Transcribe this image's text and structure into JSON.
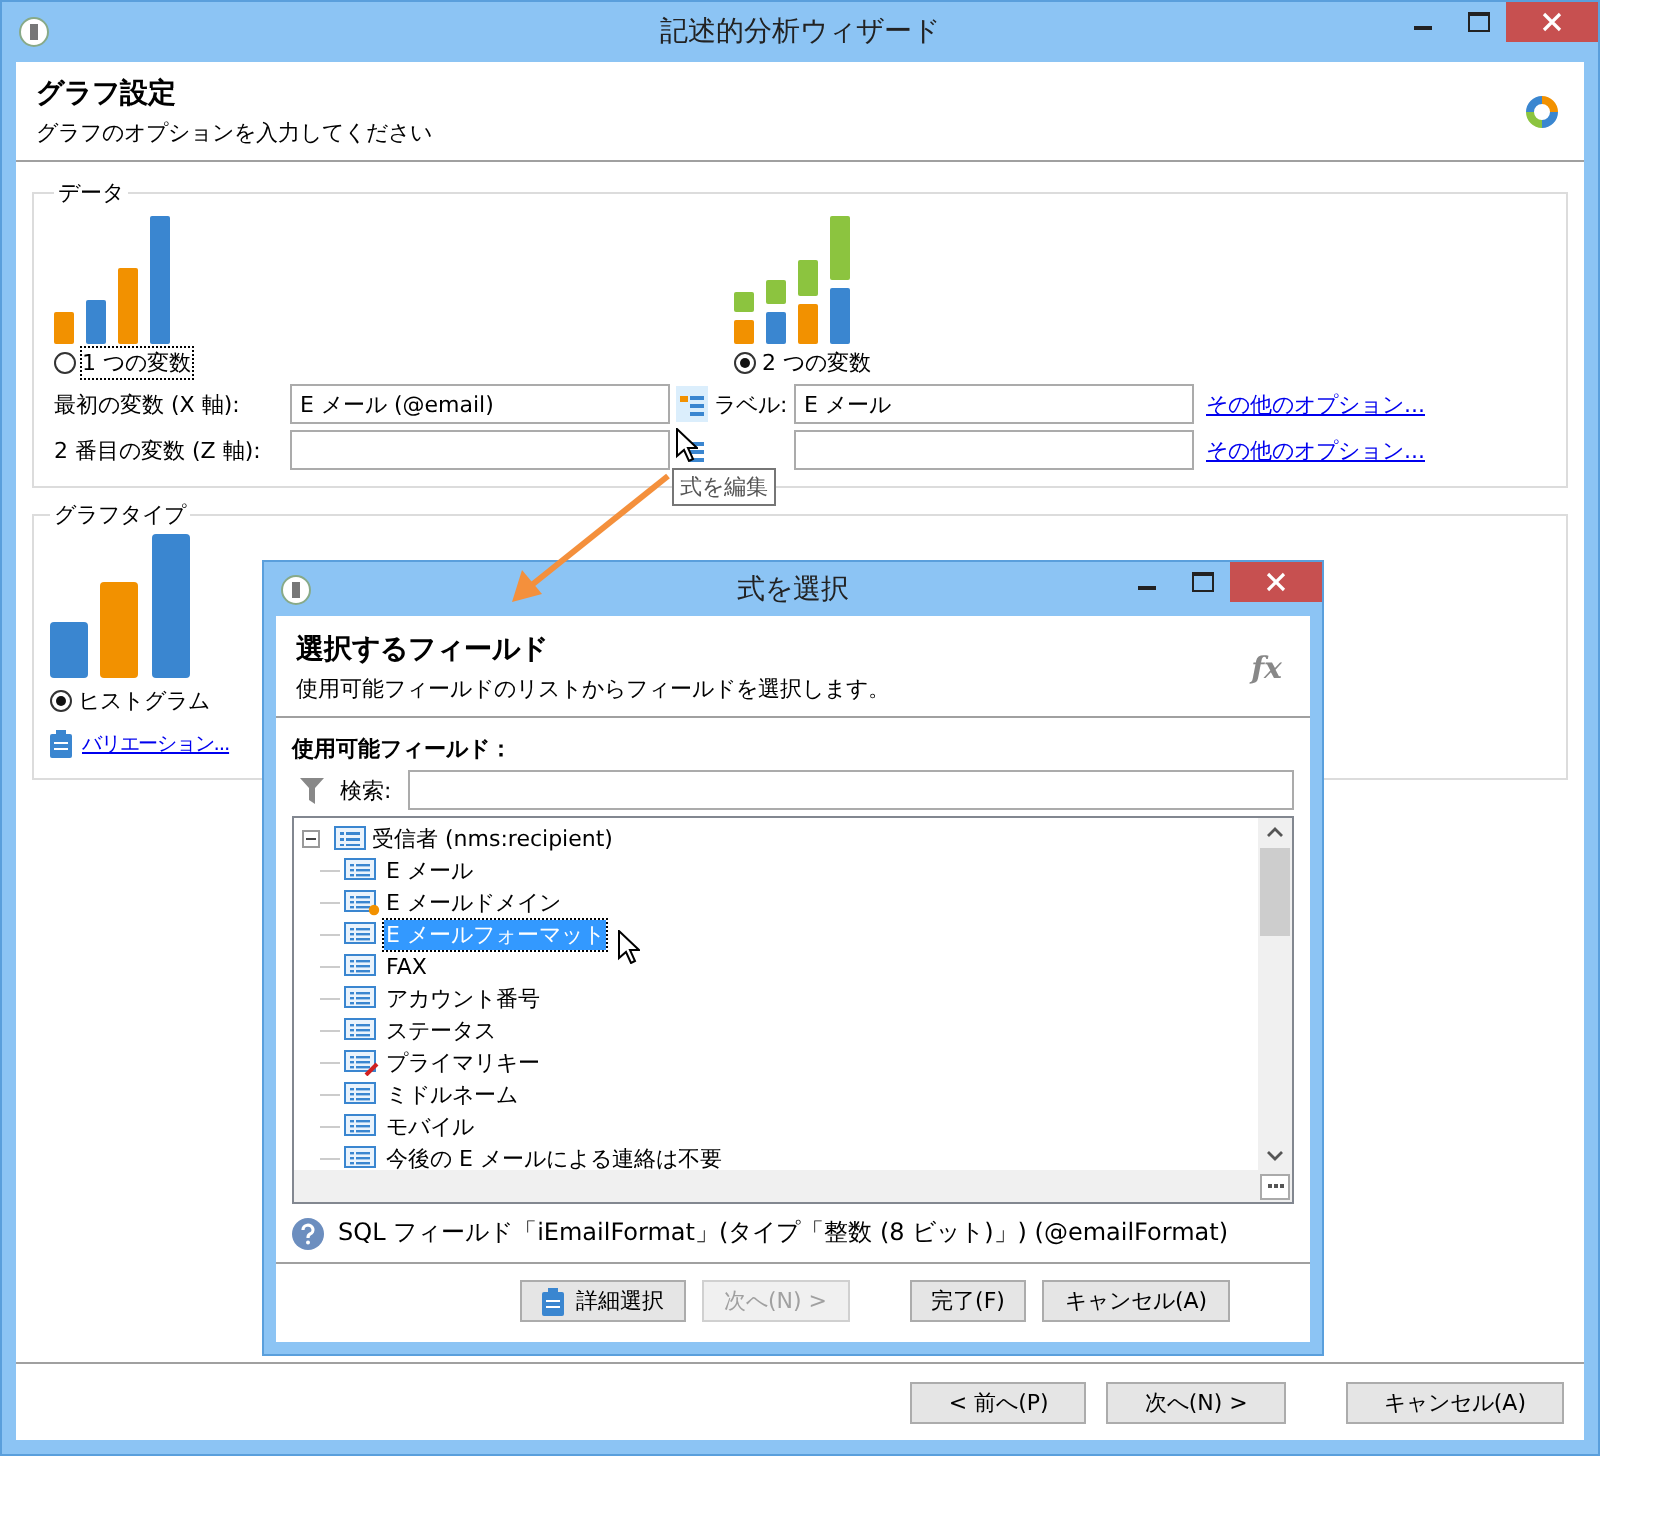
{
  "window": {
    "title": "記述的分析ウィザード"
  },
  "header": {
    "title": "グラフ設定",
    "subtitle": "グラフのオプションを入力してください"
  },
  "data_group": {
    "legend": "データ",
    "options": [
      {
        "label": "1 つの変数",
        "selected": false,
        "kind": "single"
      },
      {
        "label": "2 つの変数",
        "selected": true,
        "kind": "double"
      }
    ],
    "fields": [
      {
        "label": "最初の変数 (X 軸):",
        "value": "E メール (@email)",
        "side_label": "ラベル:",
        "side_value": "E メール",
        "link": "その他のオプション..."
      },
      {
        "label": "2 番目の変数 (Z 軸):",
        "link": "その他のオプション..."
      }
    ]
  },
  "tooltip": "式を編集",
  "graph_type": {
    "legend": "グラフタイプ",
    "options": [
      {
        "label": "ヒストグラム",
        "selected": true
      }
    ],
    "variation_link": "バリエーション..."
  },
  "buttons": [
    {
      "label": "< 前へ(P)",
      "disabled": false
    },
    {
      "label": "次へ(N) >",
      "disabled": false
    },
    {
      "label": "キャンセル(A)",
      "disabled": false
    }
  ],
  "dialog": {
    "title": "式を選択",
    "heading": "選択するフィールド",
    "subtitle": "使用可能フィールドのリストからフィールドを選択します。",
    "formula_icon": "fx",
    "fields_label": "使用可能フィールド：",
    "search_label": "検索:",
    "tree": [
      {
        "label": "受信者 (nms:recipient)",
        "expanded": true,
        "children": [
          {
            "label": "E メール",
            "kind": "field",
            "selected": false
          },
          {
            "label": "E メールドメイン",
            "kind": "computed",
            "selected": false
          },
          {
            "label": "E メールフォーマット",
            "kind": "field",
            "selected": true
          },
          {
            "label": "FAX",
            "kind": "field",
            "selected": false
          },
          {
            "label": "アカウント番号",
            "kind": "field",
            "selected": false
          },
          {
            "label": "ステータス",
            "kind": "field",
            "selected": false
          },
          {
            "label": "プライマリキー",
            "kind": "key",
            "selected": false
          },
          {
            "label": "ミドルネーム",
            "kind": "field",
            "selected": false
          },
          {
            "label": "モバイル",
            "kind": "field",
            "selected": false
          },
          {
            "label": "今後の E メールによる連絡は不要",
            "kind": "field",
            "selected": false
          }
        ]
      }
    ],
    "info": "SQL フィールド「iEmailFormat」(タイプ「整数 (8 ビット)」) (@emailFormat)",
    "buttons": [
      {
        "label": "詳細選択",
        "kind": "icon",
        "disabled": false
      },
      {
        "label": "次へ(N) >",
        "kind": "plain",
        "disabled": true
      },
      {
        "label": "完了(F)",
        "kind": "plain",
        "disabled": false
      },
      {
        "label": "キャンセル(A)",
        "kind": "plain",
        "disabled": false
      }
    ]
  }
}
